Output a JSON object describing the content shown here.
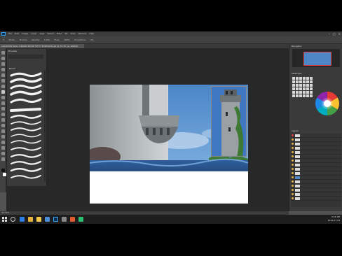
{
  "app": {
    "menu": [
      "File",
      "Edit",
      "Image",
      "Layer",
      "Type",
      "Select",
      "Filter",
      "3D",
      "View",
      "Window",
      "Help"
    ],
    "window_controls": [
      "–",
      "□",
      "✕"
    ]
  },
  "options_bar": {
    "items": [
      "Mode:",
      "Normal",
      "Opacity:",
      "100%",
      "Flow:",
      "100%",
      "Smoothing:",
      "0%"
    ]
  },
  "document": {
    "tab_title": "LOCATION WALL DRAWN MOVIE MYTH PORTRAIT.psd @ 33.3% (A, RGB/8)"
  },
  "brush_panel": {
    "title": "Brushes",
    "section_label": "Brush"
  },
  "right_panel": {
    "navigator_label": "Navigator",
    "swatches_label": "Swatches",
    "layers_label": "Layers",
    "layer_rows": 16,
    "accent_color": "#e03c3c"
  },
  "status": {
    "zoom": "33.33%"
  },
  "taskbar": {
    "time": "3:51 PM",
    "date": "2019-07-03",
    "app_icons": [
      "edge-icon",
      "chrome-icon",
      "files-icon",
      "mail-icon",
      "photoshop-icon",
      "store-icon",
      "player-icon",
      "music-icon"
    ]
  }
}
